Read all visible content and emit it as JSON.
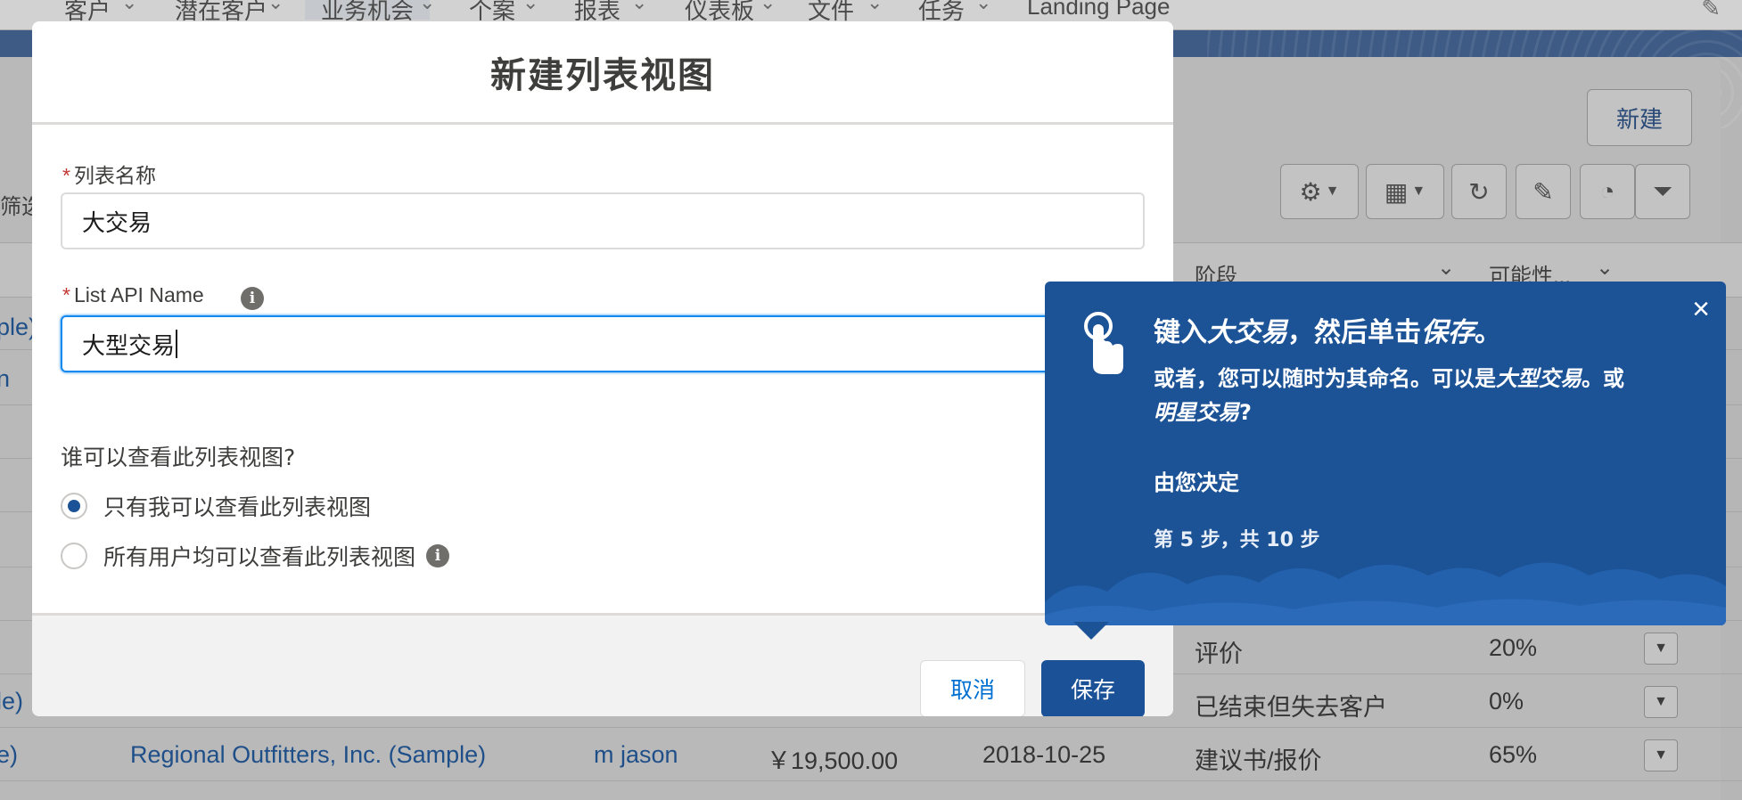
{
  "nav": {
    "items": [
      "客户",
      "潜在客户",
      "业务机会",
      "个案",
      "报表",
      "仪表板",
      "文件",
      "任务",
      "Landing Page"
    ],
    "active_index": 2
  },
  "list_view": {
    "new_button": "新建",
    "filter_label": "筛选",
    "columns": {
      "stage": "阶段",
      "probability": "可能性..."
    },
    "edge_rows": [
      "ple)",
      "n",
      "",
      "",
      "",
      "",
      "",
      "",
      "",
      "le)",
      "e)",
      "e)"
    ],
    "rows": [
      {
        "stage": "评价",
        "probability": "20%"
      },
      {
        "stage": "已结束但失去客户",
        "probability": "0%"
      },
      {
        "account": "Regional Outfitters, Inc. (Sample)",
        "owner": "m jason",
        "amount": "￥19,500.00",
        "close_date": "2018-10-25",
        "stage": "建议书/报价",
        "probability": "65%"
      }
    ]
  },
  "modal": {
    "title": "新建列表视图",
    "list_name": {
      "label": "列表名称",
      "value": "大交易"
    },
    "api_name": {
      "label": "List API Name",
      "value": "大型交易"
    },
    "required_marker": "*",
    "visibility_question": "谁可以查看此列表视图?",
    "options": [
      {
        "label": "只有我可以查看此列表视图",
        "checked": true
      },
      {
        "label": "所有用户均可以查看此列表视图",
        "checked": false
      }
    ],
    "cancel_label": "取消",
    "save_label": "保存"
  },
  "walkthrough": {
    "title_prefix": "键入",
    "title_name": "大交易",
    "title_mid": "，然后单击",
    "title_action": "保存",
    "title_suffix": "。",
    "body_1": "或者，您可以随时为其命名。可以是",
    "body_opt1": "大型交易",
    "body_2": "。或",
    "body_opt2": "明星交易",
    "body_3": "?",
    "decide": "由您决定",
    "step": "第 5 步，共 10 步",
    "close_glyph": "×"
  },
  "colors": {
    "brand": "#1b5297",
    "popover": "#1c5296",
    "required": "#c23934",
    "focus": "#1589ee"
  }
}
